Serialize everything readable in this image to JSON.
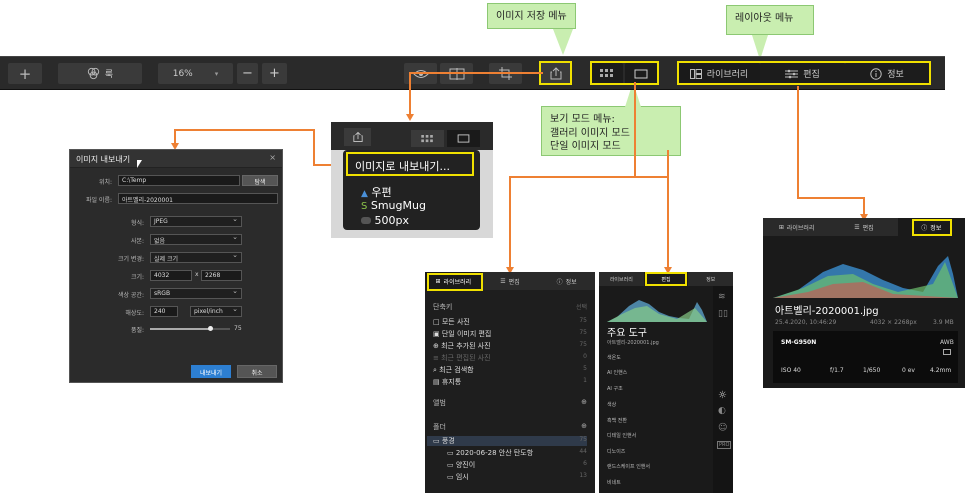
{
  "callouts": {
    "save_menu": "이미지 저장 메뉴",
    "layout_menu": "레이아웃 메뉴",
    "view_mode": [
      "보기 모드 메뉴:",
      "갤러리 이미지 모드",
      "단일 이미지 모드"
    ]
  },
  "toolbar": {
    "add_symbol": "+",
    "look_label": "룩",
    "zoom_value": "16%",
    "zoom_minus": "−",
    "zoom_plus": "+",
    "tabs": [
      "라이브러리",
      "편집",
      "정보"
    ]
  },
  "export_popup": {
    "header": "이미지로 내보내기...",
    "items": [
      "우편",
      "SmugMug",
      "500px"
    ]
  },
  "export_dialog": {
    "title": "이미지 내보내기",
    "close": "×",
    "location_label": "위치:",
    "location_value": "C:\\Temp",
    "browse_button": "탐색",
    "filename_label": "파일 이름:",
    "filename_value": "아트벨리-2020001",
    "format_label": "형식:",
    "format_value": "JPEG",
    "metadata_label": "사본:",
    "metadata_value": "없음",
    "resize_label": "크기 변경:",
    "resize_value": "실제 크기",
    "size_label": "크기:",
    "width_value": "4032",
    "size_sep": "x",
    "height_value": "2268",
    "colorspace_label": "색상 공간:",
    "colorspace_value": "sRGB",
    "resolution_label": "해상도:",
    "resolution_value": "240",
    "resolution_unit": "pixel/inch",
    "quality_label": "품질:",
    "quality_value": "75",
    "quality_level": 0.75,
    "export_button": "내보내기",
    "cancel_button": "취소"
  },
  "library_panel": {
    "tabs": [
      "라이브러리",
      "편집",
      "정보"
    ],
    "shortcuts_header": "단축키",
    "select_label": "선택",
    "shortcuts": [
      {
        "label": "모든 사진",
        "count": "75"
      },
      {
        "label": "단일 이미지 편집",
        "count": "75"
      },
      {
        "label": "최근 추가된 사진",
        "count": "75"
      },
      {
        "label": "최근 편집된 사진",
        "count": "0"
      },
      {
        "label": "최근 검색함",
        "count": "5"
      },
      {
        "label": "휴지통",
        "count": "1"
      }
    ],
    "albums_header": "앨범",
    "folders_header": "폴더",
    "folders": [
      {
        "label": "풍경",
        "count": "75"
      },
      {
        "label": "2020-06-28 안산 탄도항",
        "count": "44"
      },
      {
        "label": "양진이",
        "count": "6"
      },
      {
        "label": "임시",
        "count": "13"
      }
    ]
  },
  "edit_panel": {
    "tabs": [
      "라이브러리",
      "편집",
      "정보"
    ],
    "title": "주요 도구",
    "filename": "아트벨리-2020001.jpg",
    "tools": [
      "색온도",
      "AI 인핸스",
      "AI 구조",
      "색상",
      "흑백 전환",
      "디테일 인핸서",
      "디노이즈",
      "랜드스케이프 인핸서",
      "비네트"
    ]
  },
  "info_panel": {
    "tabs": [
      "라이브러리",
      "편집",
      "정보"
    ],
    "filename": "아트벨리-2020001.jpg",
    "date": "25.4.2020, 10:46:29",
    "dimensions": "4032 × 2268px",
    "filesize": "3.9 MB",
    "camera": "SM-G950N",
    "wb": "AWB",
    "iso": "ISO 40",
    "aperture": "f/1.7",
    "shutter": "1/650",
    "ev": "0 ev",
    "focal": "4.2mm"
  },
  "colors": {
    "accent_yellow": "#f0e000",
    "arrow_orange": "#ee8033",
    "callout_green": "#c9eeb0",
    "export_blue": "#2d7fd2"
  }
}
